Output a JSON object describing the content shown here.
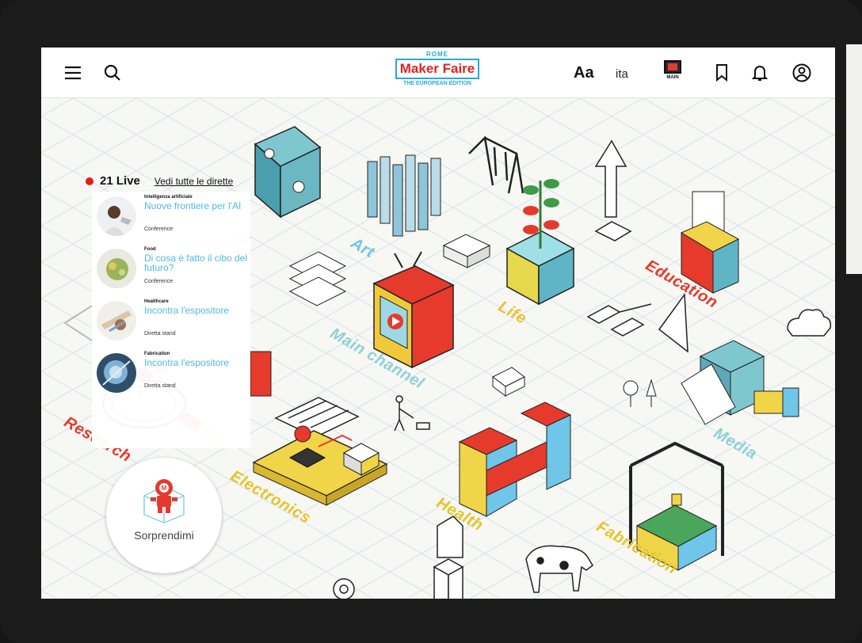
{
  "header": {
    "menu_icon": "hamburger-icon",
    "search_icon": "search-icon",
    "logo": {
      "top": "ROME",
      "name": "Maker Faire",
      "edition": "THE EUROPEAN EDITION"
    },
    "font_size_label": "Aa",
    "language": "ita",
    "tv_label": "MAIN",
    "bookmark_icon": "bookmark-icon",
    "bell_icon": "bell-icon",
    "account_icon": "user-circle-icon"
  },
  "live": {
    "count_number": "21",
    "count_word": "Live",
    "see_all": "Vedi tutte le dirette",
    "items": [
      {
        "category": "Intelligenza artificiale",
        "title": "Nuove frontiere per l'AI",
        "type": "Conference"
      },
      {
        "category": "Food",
        "title": "Di cosa è fatto il cibo del futuro?",
        "type": "Conference"
      },
      {
        "category": "Healthcare",
        "title": "Incontra l'espositore",
        "type": "Diretta stand"
      },
      {
        "category": "Fabrication",
        "title": "Incontra l'espositore",
        "type": "Diretta stand"
      }
    ]
  },
  "categories": {
    "art": "Art",
    "life": "Life",
    "education": "Education",
    "main_channel": "Main channel",
    "research": "Research",
    "electronics": "Electronics",
    "health": "Health",
    "media": "Media",
    "fabrication": "Fabrication",
    "partial_m": "M"
  },
  "surprise": {
    "label": "Sorprendimi",
    "icon": "robot-icon"
  },
  "colors": {
    "accent_blue": "#27a7df",
    "accent_red": "#e32222",
    "live_red": "#e21b1b"
  }
}
